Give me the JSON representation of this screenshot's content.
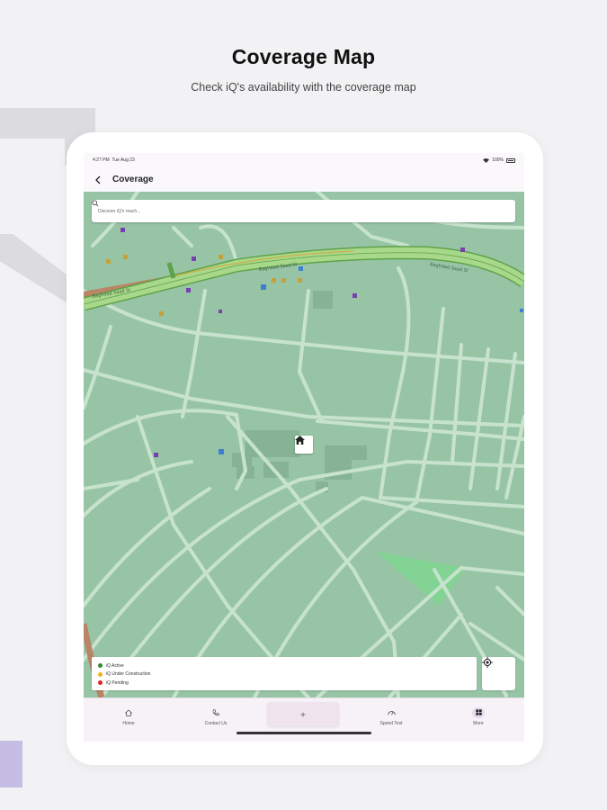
{
  "hero": {
    "title": "Coverage Map",
    "subtitle": "Check iQ's availability with the coverage map"
  },
  "status_bar": {
    "time": "4:27 PM",
    "date": "Tue Aug 23",
    "battery": "100%"
  },
  "app_bar": {
    "title": "Coverage"
  },
  "search": {
    "placeholder": "Discover iQ's reach..."
  },
  "map": {
    "street_labels": [
      "Baghdad Saad St",
      "Baghdad Saad St",
      "Baghdad Saad St"
    ],
    "colors": {
      "land": "#98c4a6",
      "road": "#c7e3cd",
      "highway": "#a8d88a",
      "highway_casing": "#5fa24a",
      "rail": "#b98566",
      "park": "#83d394",
      "building": "#86b394"
    }
  },
  "legend": {
    "items": [
      {
        "label": "iQ Active",
        "color": "#2e8b2e"
      },
      {
        "label": "iQ Under Construction",
        "color": "#f2b01e"
      },
      {
        "label": "iQ Pending",
        "color": "#e02424"
      }
    ]
  },
  "bottom_nav": {
    "items": [
      {
        "label": "Home",
        "icon": "home-icon"
      },
      {
        "label": "Contact Us",
        "icon": "phone-icon"
      },
      {
        "label": "Speed Test",
        "icon": "speedometer-icon"
      },
      {
        "label": "More",
        "icon": "grid-icon"
      }
    ],
    "fab_icon": "plus-icon",
    "active_color": "#e6dbef"
  }
}
